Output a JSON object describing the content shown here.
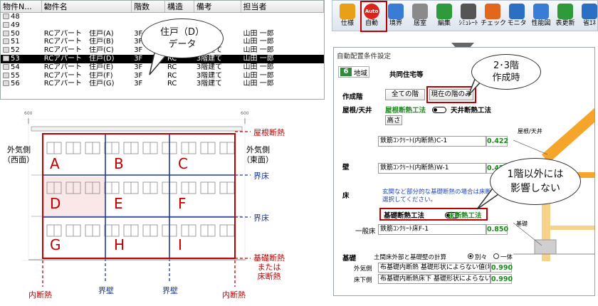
{
  "table": {
    "headers": [
      "物件N...",
      "物件名",
      "階数",
      "構造",
      "備考",
      "担当者"
    ],
    "rows": [
      {
        "no": "48",
        "name": "",
        "floors": "",
        "structure": "",
        "note": "",
        "owner": ""
      },
      {
        "no": "49",
        "name": "",
        "floors": "",
        "structure": "",
        "note": "",
        "owner": ""
      },
      {
        "no": "50",
        "name": "RCアパート　住戸(A)",
        "floors": "3F",
        "structure": "RC",
        "note": "3階建て",
        "owner": "山田 一郎"
      },
      {
        "no": "51",
        "name": "RCアパート　住戸(B)",
        "floors": "3F",
        "structure": "RC",
        "note": "3階建て",
        "owner": "山田 一郎"
      },
      {
        "no": "52",
        "name": "RCアパート　住戸(C)",
        "floors": "3F",
        "structure": "RC",
        "note": "3階建て",
        "owner": "山田 一郎"
      },
      {
        "no": "53",
        "name": "RCアパート　住戸(D)",
        "floors": "3F",
        "structure": "RC",
        "note": "3階建て",
        "owner": "山田 一郎"
      },
      {
        "no": "54",
        "name": "RCアパート　住戸(E)",
        "floors": "3F",
        "structure": "RC",
        "note": "3階建て",
        "owner": "山田 一郎"
      },
      {
        "no": "55",
        "name": "RCアパート　住戸(F)",
        "floors": "3F",
        "structure": "RC",
        "note": "3階建て",
        "owner": "山田 一郎"
      },
      {
        "no": "56",
        "name": "RCアパート　住戸(G)",
        "floors": "3F",
        "structure": "RC",
        "note": "3階建て",
        "owner": "山田 一郎"
      }
    ],
    "selected_no": "53"
  },
  "callout_left": {
    "line1": "住戸（D）",
    "line2": "データ"
  },
  "building": {
    "dim_left": "600",
    "dim_right": "600",
    "cells": [
      "A",
      "B",
      "C",
      "D",
      "E",
      "F",
      "G",
      "H",
      "I"
    ],
    "west_line1": "外気側",
    "west_line2": "（西面）",
    "east_line1": "外気側",
    "east_line2": "（東面）",
    "roof_insulation": "屋根断熱",
    "floor_slab_1": "界床",
    "floor_slab_2": "界床",
    "base_line1": "基礎断熱",
    "base_line2": "または",
    "base_line3": "床断熱",
    "inner_left": "内断熱",
    "inner_right": "内断熱",
    "party_wall_1": "界壁",
    "party_wall_2": "界壁"
  },
  "toolbar": {
    "items": [
      "仕様",
      "自動",
      "境界",
      "居室",
      "編集",
      "ｼﾐｭﾚｰﾄ",
      "チェック",
      "モニタ",
      "性能図",
      "表更新",
      "省ｴﾈ"
    ],
    "auto_icon_text": "Auto"
  },
  "dialog": {
    "title": "自動配置条件設定",
    "region_no": "6",
    "region_label": "地域",
    "building_type": "共同住宅等",
    "create_floor_label": "作成階",
    "all_floors_btn": "全ての階",
    "current_floor_btn": "現在の階のみ",
    "roof_label": "屋根/天井",
    "roof_method": "屋根断熱工法",
    "ceiling_method": "天井断熱工法",
    "height_btn": "高さ",
    "roof_spec": "鉄筋ｺﾝｸﾘｰﾄ(内断熱)C-1",
    "roof_value": "0.422",
    "wall_label": "壁",
    "wall_spec": "鉄筋ｺﾝｸﾘｰﾄ(内断熱)W-1",
    "wall_value": "0.422",
    "floor_label": "床",
    "floor_note1": "玄関など部分的な基礎断熱の場合は床断熱工法を",
    "floor_note2": "選択してください。",
    "base_method": "基礎断熱工法",
    "floor_method": "床断熱工法",
    "general_floor_label": "一般床",
    "floor_spec": "鉄筋ｺﾝｸﾘｰﾄ床F-1",
    "floor_value": "0.850",
    "foundation_label": "基礎",
    "foundation_calc": "土間床外部と基礎壁の計算",
    "option_separate": "別々",
    "option_together": "一体",
    "outside_label": "外気側",
    "outside_spec": "布基礎内断熱 基礎形状によらない値(地盤面",
    "outside_value": "0.990",
    "underfloor_label": "床下側",
    "underfloor_spec": "布基礎内断熱床下 基礎形状によらない値(地",
    "underfloor_value": "0.990",
    "diagram_roof": "屋根/天井",
    "diagram_ceiling": "天井",
    "diagram_base": "基礎"
  },
  "callout_23": {
    "line1": "2･3階",
    "line2": "作成時"
  },
  "callout_1f": {
    "line1": "1階以外には",
    "line2": "影響しない"
  }
}
